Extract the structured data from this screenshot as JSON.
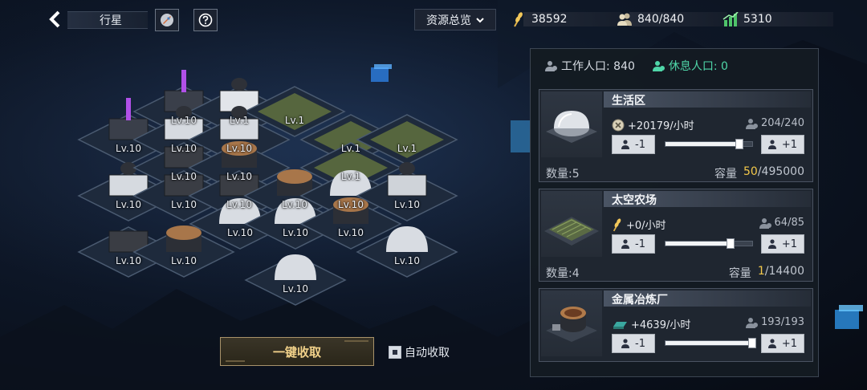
{
  "topbar": {
    "title": "行星",
    "resource_overview": "资源总览",
    "resources": [
      {
        "icon": "wheat-icon",
        "value": "38592"
      },
      {
        "icon": "population-icon",
        "value": "840/840"
      },
      {
        "icon": "production-chart-icon",
        "value": "5310"
      }
    ]
  },
  "grid": {
    "tiles": [
      {
        "label": "Lv.10",
        "building": "energy-tower"
      },
      {
        "label": "Lv.10",
        "building": "energy-tower"
      },
      {
        "label": "Lv.1",
        "building": "radar-tower"
      },
      {
        "label": "Lv.1",
        "building": "farm"
      },
      {
        "label": "Lv.10",
        "building": "radar-station"
      },
      {
        "label": "Lv.10",
        "building": "radar-station"
      },
      {
        "label": "Lv.1",
        "building": "farm"
      },
      {
        "label": "Lv.1",
        "building": "farm"
      },
      {
        "label": "Lv.10",
        "building": "radar-station"
      },
      {
        "label": "Lv.10",
        "building": "factory"
      },
      {
        "label": "Lv.10",
        "building": "smelter"
      },
      {
        "label": "Lv.1",
        "building": "farm"
      },
      {
        "label": "Lv.10",
        "building": "factory"
      },
      {
        "label": "Lv.10",
        "building": "factory"
      },
      {
        "label": "Lv.10",
        "building": "smelter"
      },
      {
        "label": "Lv.10",
        "building": "dome"
      },
      {
        "label": "Lv.10",
        "building": "reactor"
      },
      {
        "label": "Lv.10",
        "building": "factory"
      },
      {
        "label": "Lv.10",
        "building": "smelter"
      },
      {
        "label": "Lv.10",
        "building": "dome"
      },
      {
        "label": "Lv.10",
        "building": "dome"
      },
      {
        "label": "Lv.10",
        "building": "smelter"
      },
      {
        "label": "Lv.10",
        "building": "dome"
      },
      {
        "label": "Lv.10",
        "building": "dome"
      }
    ]
  },
  "bottom": {
    "collect_all": "一键收取",
    "auto_collect": "自动收取",
    "auto_collect_checked": true
  },
  "panel": {
    "working_population": "工作人口: 840",
    "resting_population": "休息人口: 0",
    "cards": [
      {
        "name": "生活区",
        "rate_icon": "coin-icon",
        "rate": "+20179/小时",
        "workers": "204/240",
        "minus": "-1",
        "plus": "+1",
        "slider_fraction": 0.85,
        "count": "数量:5",
        "capacity_label": "容量",
        "capacity_current": "50",
        "capacity_max": "/495000"
      },
      {
        "name": "太空农场",
        "rate_icon": "wheat-icon",
        "rate": "+0/小时",
        "workers": "64/85",
        "minus": "-1",
        "plus": "+1",
        "slider_fraction": 0.75,
        "count": "数量:4",
        "capacity_label": "容量",
        "capacity_current": "1",
        "capacity_max": "/14400"
      },
      {
        "name": "金属冶炼厂",
        "rate_icon": "metal-ingot-icon",
        "rate": "+4639/小时",
        "workers": "193/193",
        "minus": "-1",
        "plus": "+1",
        "slider_fraction": 1.0
      }
    ]
  }
}
